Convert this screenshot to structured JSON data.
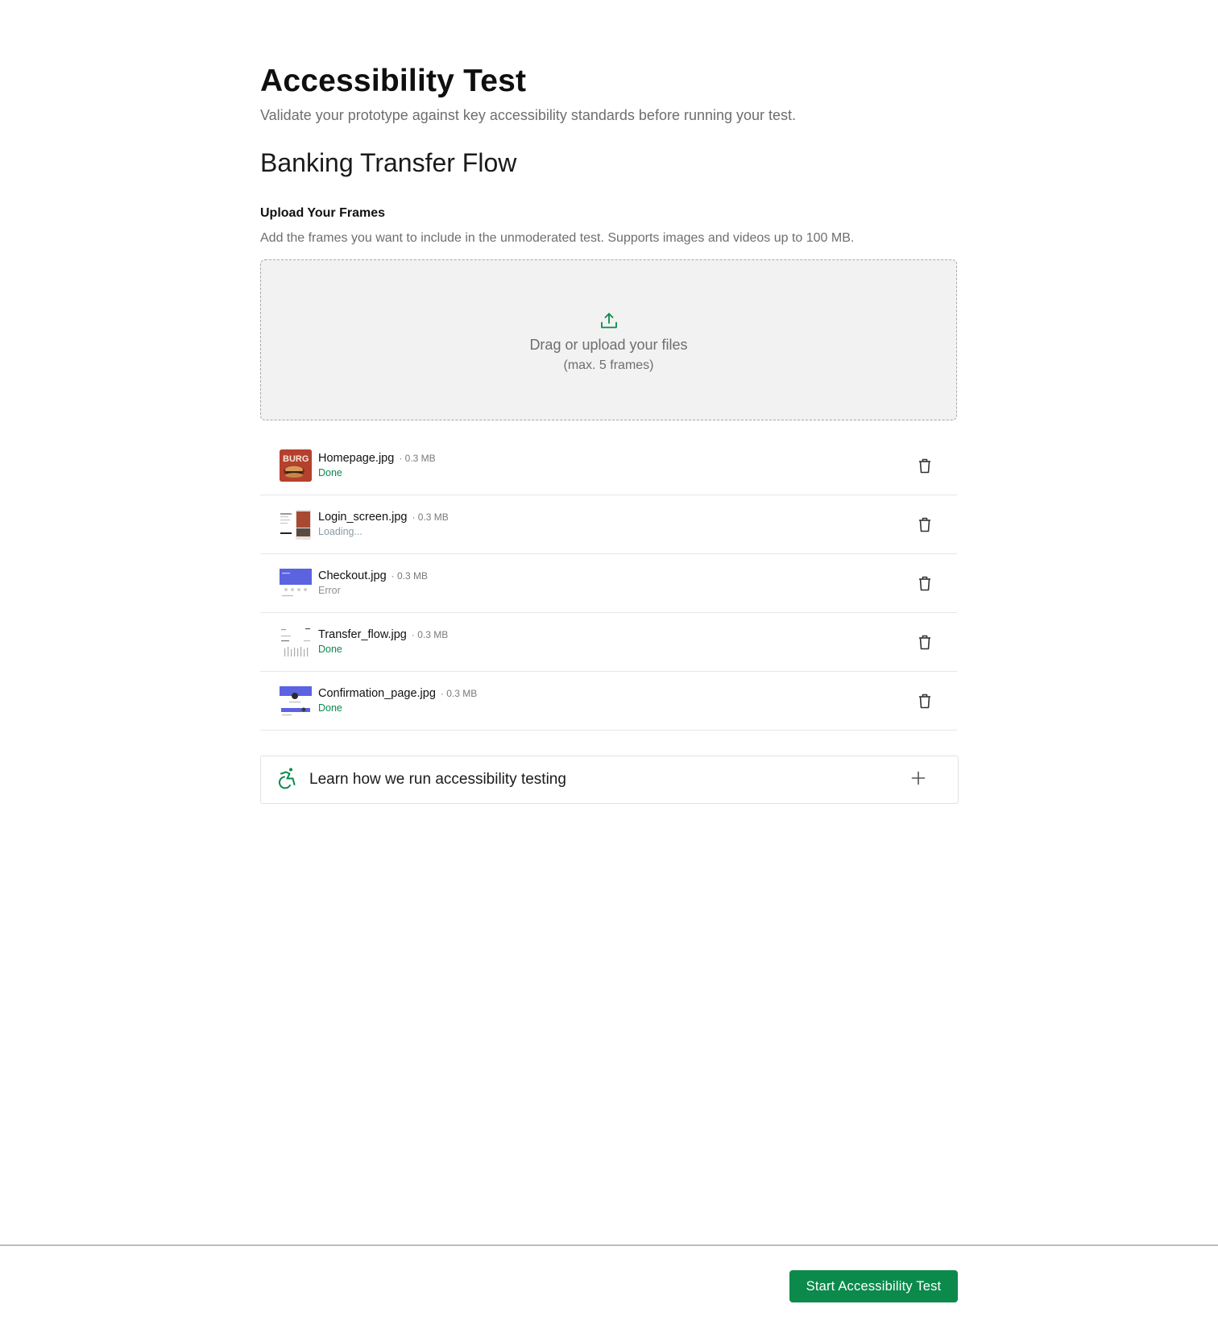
{
  "header": {
    "title": "Accessibility Test",
    "subtitle": "Validate your prototype against key accessibility standards before running your test."
  },
  "project": {
    "name": "Banking Transfer Flow"
  },
  "upload": {
    "section_title": "Upload Your Frames",
    "description": "Add the frames you want to include in the unmoderated test. Supports images and videos up to 100 MB.",
    "dropzone_text": "Drag or upload your files",
    "dropzone_hint": "(max. 5 frames)",
    "icon": "upload-icon",
    "accent_color": "#0b8a4c"
  },
  "files": [
    {
      "name": "Homepage.jpg",
      "size": "· 0.3 MB",
      "status": "Done",
      "thumb_text": "BURG"
    },
    {
      "name": "Login_screen.jpg",
      "size": "· 0.3 MB",
      "status": "Loading..."
    },
    {
      "name": "Checkout.jpg",
      "size": "· 0.3 MB",
      "status": "Error"
    },
    {
      "name": "Transfer_flow.jpg",
      "size": "· 0.3 MB",
      "status": "Done"
    },
    {
      "name": "Confirmation_page.jpg",
      "size": "· 0.3 MB",
      "status": "Done"
    }
  ],
  "accordion": {
    "label": "Learn how we run accessibility testing",
    "icon": "accessibility-icon",
    "toggle_icon": "plus-icon"
  },
  "footer": {
    "primary_button": "Start Accessibility Test",
    "button_color": "#0b8a4c"
  }
}
